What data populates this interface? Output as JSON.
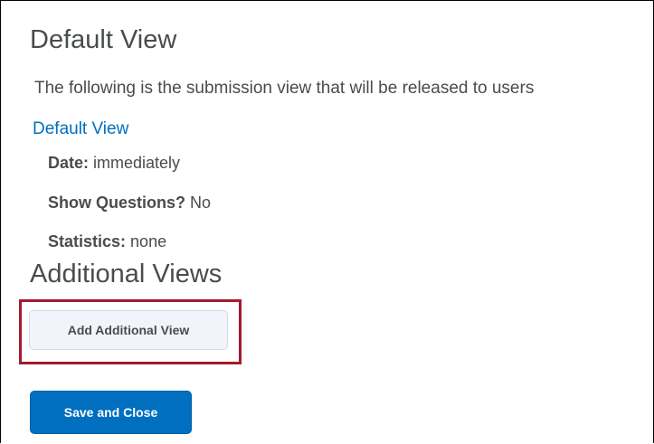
{
  "default_view": {
    "heading": "Default View",
    "description": "The following is the submission view that will be released to users",
    "link_label": "Default View",
    "properties": {
      "date": {
        "label": "Date:",
        "value": "immediately"
      },
      "show_questions": {
        "label": "Show Questions?",
        "value": "No"
      },
      "statistics": {
        "label": "Statistics:",
        "value": "none"
      }
    }
  },
  "additional_views": {
    "heading": "Additional Views",
    "add_button_label": "Add Additional View"
  },
  "actions": {
    "save_close_label": "Save and Close"
  },
  "colors": {
    "text": "#494c4e",
    "link": "#006fbf",
    "primary_button": "#006fbf",
    "secondary_button": "#f1f5fb",
    "highlight": "#a6192e"
  }
}
